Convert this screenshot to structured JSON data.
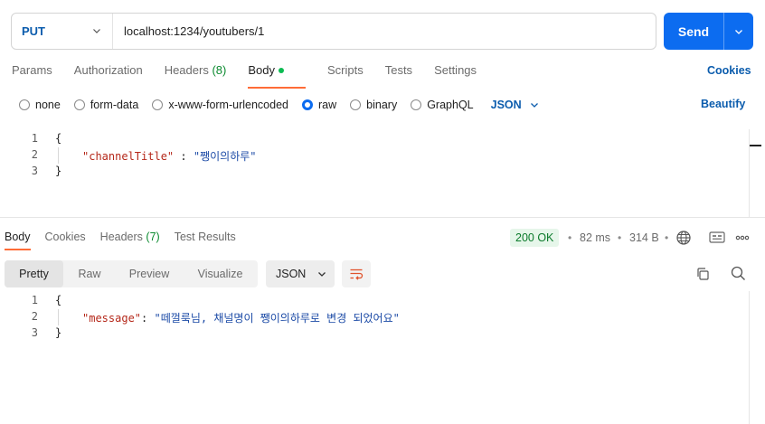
{
  "request": {
    "method": "PUT",
    "url": "localhost:1234/youtubers/1",
    "send_label": "Send"
  },
  "request_tabs": {
    "params": "Params",
    "authorization": "Authorization",
    "headers": "Headers",
    "headers_count": "(8)",
    "body": "Body",
    "scripts": "Scripts",
    "tests": "Tests",
    "settings": "Settings",
    "cookies": "Cookies"
  },
  "body_types": {
    "none": "none",
    "form_data": "form-data",
    "urlencoded": "x-www-form-urlencoded",
    "raw": "raw",
    "binary": "binary",
    "graphql": "GraphQL",
    "format": "JSON",
    "beautify": "Beautify"
  },
  "request_body": {
    "line_numbers": [
      "1",
      "2",
      "3"
    ],
    "open_brace": "{",
    "key": "\"channelTitle\"",
    "colon": " : ",
    "value": "\"쨍이의하루\"",
    "close_brace": "}"
  },
  "response_tabs": {
    "body": "Body",
    "cookies": "Cookies",
    "headers": "Headers",
    "headers_count": "(7)",
    "test_results": "Test Results"
  },
  "response_meta": {
    "status": "200 OK",
    "time": "82 ms",
    "size": "314 B",
    "separator": "•"
  },
  "response_view": {
    "pretty": "Pretty",
    "raw": "Raw",
    "preview": "Preview",
    "visualize": "Visualize",
    "format": "JSON"
  },
  "response_body": {
    "line_numbers": [
      "1",
      "2",
      "3"
    ],
    "open_brace": "{",
    "key": "\"message\"",
    "colon": ": ",
    "value": "\"떼껄룩님, 채널명이 쨍이의하루로 변경 되었어요\"",
    "close_brace": "}"
  },
  "colors": {
    "accent": "#0c6cf0",
    "active_tab": "#ff6c37",
    "status_ok": "#0b7a2b"
  }
}
